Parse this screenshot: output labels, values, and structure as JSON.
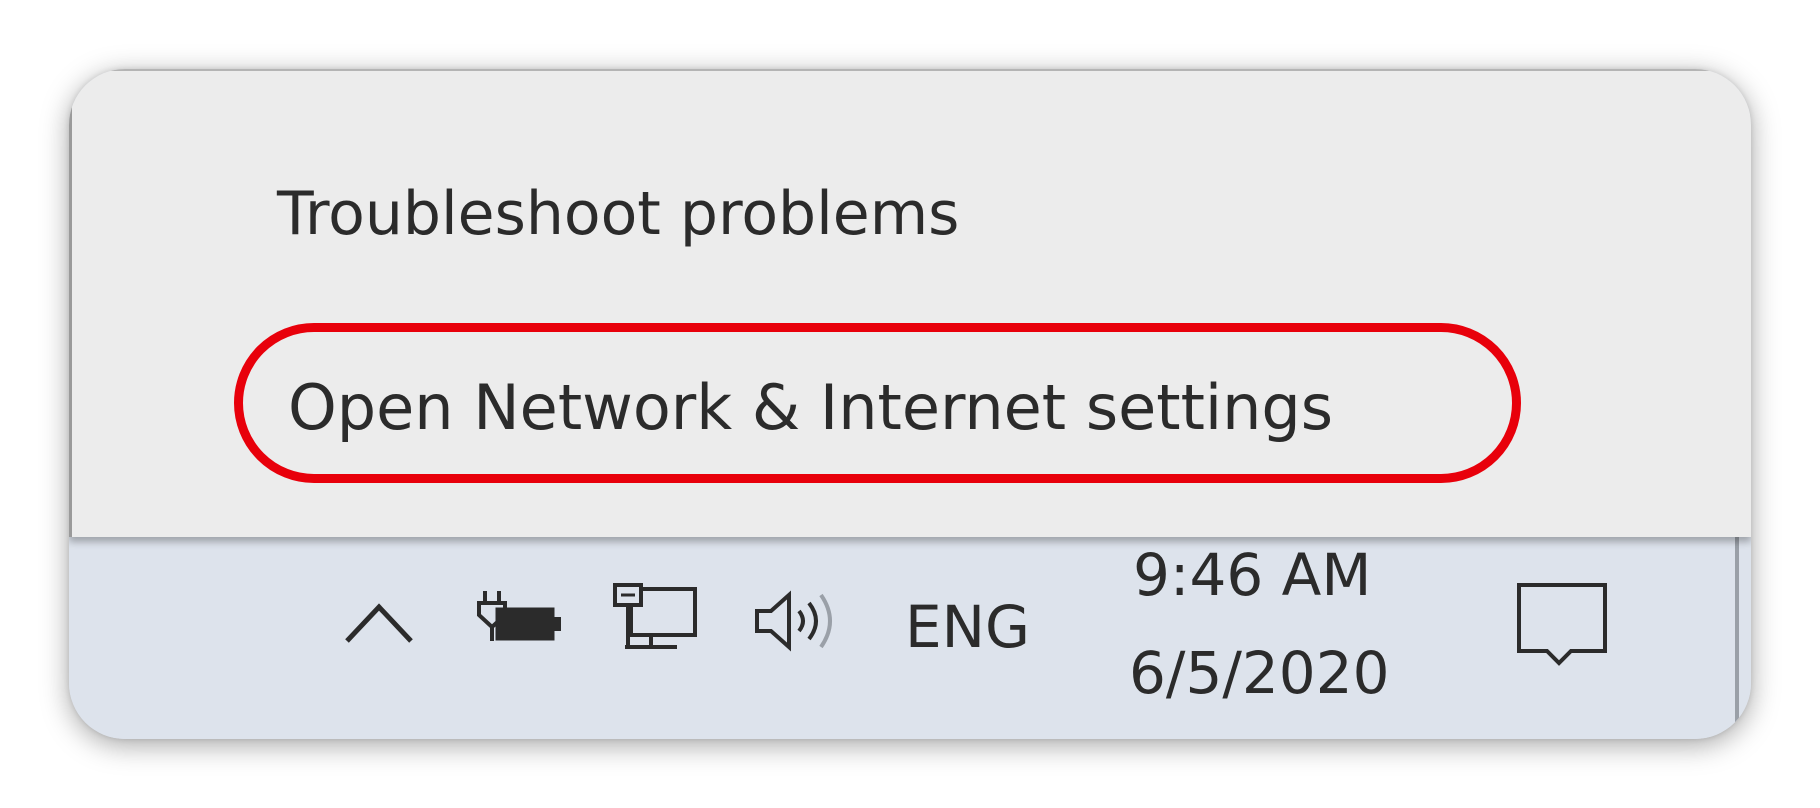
{
  "context_menu": {
    "items": [
      {
        "label": "Troubleshoot problems"
      },
      {
        "label": "Open Network & Internet settings"
      }
    ],
    "highlighted_item": "Open Network & Internet settings",
    "highlight_color": "#e8000b"
  },
  "taskbar": {
    "tray_icons": [
      {
        "icon": "chevron-up-icon"
      },
      {
        "icon": "power-plug-battery-icon"
      },
      {
        "icon": "network-ethernet-icon"
      },
      {
        "icon": "speaker-volume-icon"
      }
    ],
    "language": "ENG",
    "clock": {
      "time": "9:46 AM",
      "date": "6/5/2020"
    },
    "action_center_icon": "action-center-icon"
  },
  "colors": {
    "menu_background": "#ececec",
    "taskbar_background": "#dde3ec",
    "text": "#2b2b2b"
  }
}
